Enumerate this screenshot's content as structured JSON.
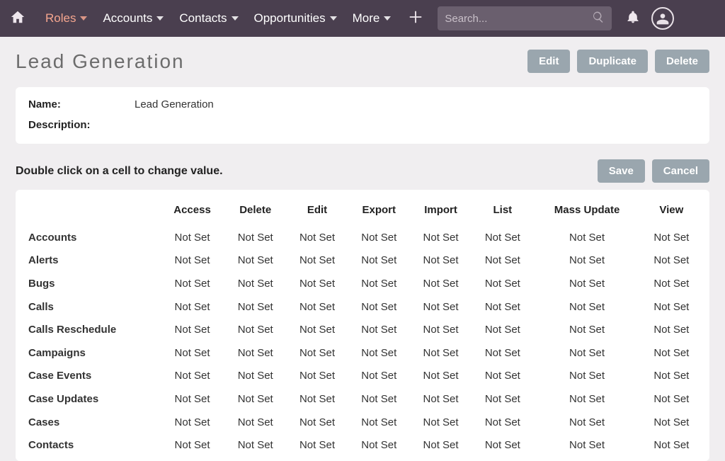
{
  "nav": {
    "items": [
      {
        "label": "Roles",
        "active": true
      },
      {
        "label": "Accounts",
        "active": false
      },
      {
        "label": "Contacts",
        "active": false
      },
      {
        "label": "Opportunities",
        "active": false
      },
      {
        "label": "More",
        "active": false
      }
    ],
    "search_placeholder": "Search..."
  },
  "header": {
    "title": "Lead Generation",
    "actions": {
      "edit": "Edit",
      "duplicate": "Duplicate",
      "delete": "Delete"
    }
  },
  "details": {
    "name_label": "Name:",
    "name_value": "Lead Generation",
    "description_label": "Description:",
    "description_value": ""
  },
  "grid": {
    "instruction": "Double click on a cell to change value.",
    "save_label": "Save",
    "cancel_label": "Cancel",
    "columns": [
      "Access",
      "Delete",
      "Edit",
      "Export",
      "Import",
      "List",
      "Mass Update",
      "View"
    ],
    "rows": [
      {
        "name": "Accounts",
        "values": [
          "Not Set",
          "Not Set",
          "Not Set",
          "Not Set",
          "Not Set",
          "Not Set",
          "Not Set",
          "Not Set"
        ]
      },
      {
        "name": "Alerts",
        "values": [
          "Not Set",
          "Not Set",
          "Not Set",
          "Not Set",
          "Not Set",
          "Not Set",
          "Not Set",
          "Not Set"
        ]
      },
      {
        "name": "Bugs",
        "values": [
          "Not Set",
          "Not Set",
          "Not Set",
          "Not Set",
          "Not Set",
          "Not Set",
          "Not Set",
          "Not Set"
        ]
      },
      {
        "name": "Calls",
        "values": [
          "Not Set",
          "Not Set",
          "Not Set",
          "Not Set",
          "Not Set",
          "Not Set",
          "Not Set",
          "Not Set"
        ]
      },
      {
        "name": "Calls Reschedule",
        "values": [
          "Not Set",
          "Not Set",
          "Not Set",
          "Not Set",
          "Not Set",
          "Not Set",
          "Not Set",
          "Not Set"
        ]
      },
      {
        "name": "Campaigns",
        "values": [
          "Not Set",
          "Not Set",
          "Not Set",
          "Not Set",
          "Not Set",
          "Not Set",
          "Not Set",
          "Not Set"
        ]
      },
      {
        "name": "Case Events",
        "values": [
          "Not Set",
          "Not Set",
          "Not Set",
          "Not Set",
          "Not Set",
          "Not Set",
          "Not Set",
          "Not Set"
        ]
      },
      {
        "name": "Case Updates",
        "values": [
          "Not Set",
          "Not Set",
          "Not Set",
          "Not Set",
          "Not Set",
          "Not Set",
          "Not Set",
          "Not Set"
        ]
      },
      {
        "name": "Cases",
        "values": [
          "Not Set",
          "Not Set",
          "Not Set",
          "Not Set",
          "Not Set",
          "Not Set",
          "Not Set",
          "Not Set"
        ]
      },
      {
        "name": "Contacts",
        "values": [
          "Not Set",
          "Not Set",
          "Not Set",
          "Not Set",
          "Not Set",
          "Not Set",
          "Not Set",
          "Not Set"
        ]
      }
    ]
  }
}
